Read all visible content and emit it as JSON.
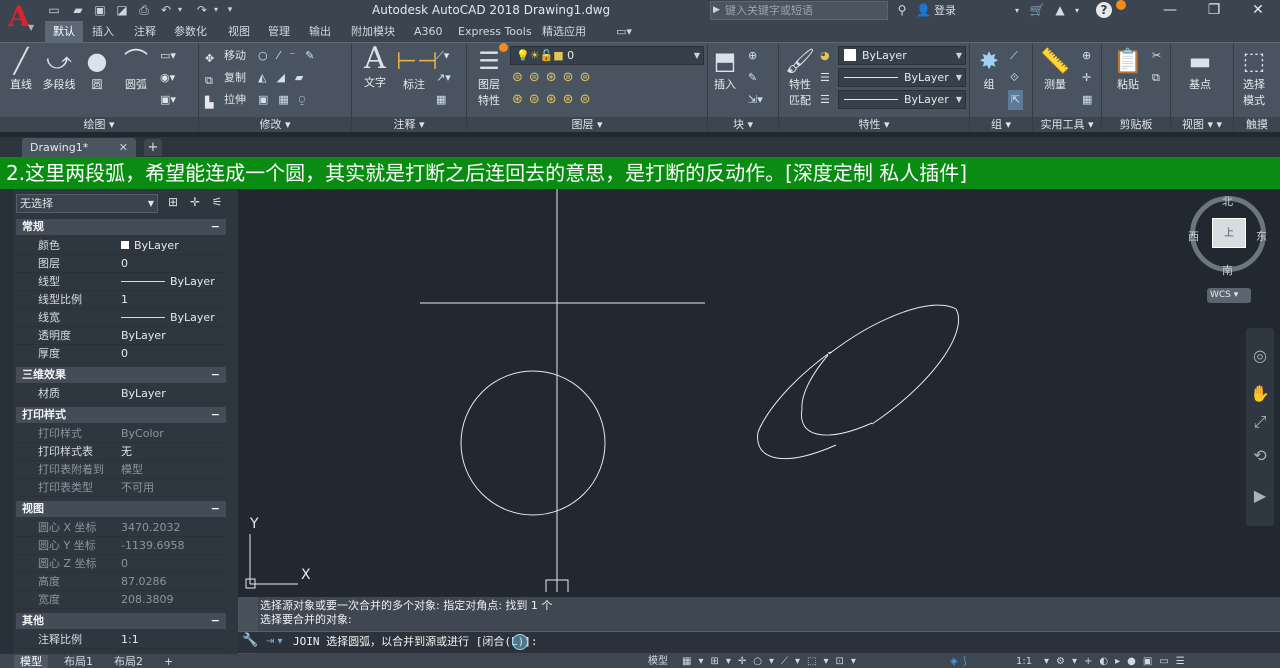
{
  "app": {
    "title": "Autodesk AutoCAD 2018    Drawing1.dwg",
    "logo": "A",
    "search_placeholder": "键入关键字或短语",
    "login_label": "登录",
    "accent_color": "#d9232e"
  },
  "ribbon_tabs": [
    "默认",
    "插入",
    "注释",
    "参数化",
    "视图",
    "管理",
    "输出",
    "附加模块",
    "A360",
    "Express Tools",
    "精选应用"
  ],
  "ribbon": {
    "draw": {
      "line": "直线",
      "polyline": "多段线",
      "circle": "圆",
      "arc": "圆弧",
      "panel": "绘图"
    },
    "modify": {
      "move": "移动",
      "copy": "复制",
      "stretch": "拉伸",
      "panel": "修改"
    },
    "annotation": {
      "text": "文字",
      "dimension": "标注",
      "panel": "注释"
    },
    "layers": {
      "properties_l1": "图层",
      "properties_l2": "特性",
      "current_layer": "0",
      "panel": "图层"
    },
    "block": {
      "insert": "插入",
      "panel": "块"
    },
    "properties": {
      "match_l1": "特性",
      "match_l2": "匹配",
      "color": "ByLayer",
      "linetype": "ByLayer",
      "lineweight": "ByLayer",
      "panel": "特性"
    },
    "groups": {
      "group": "组",
      "panel": "组"
    },
    "utilities": {
      "measure": "测量",
      "panel": "实用工具"
    },
    "clipboard": {
      "paste": "粘贴",
      "panel": "剪贴板"
    },
    "view": {
      "base": "基点",
      "panel": "视图"
    },
    "select": {
      "mode_l1": "选择",
      "mode_l2": "模式",
      "panel": "触摸"
    }
  },
  "document_tab": "Drawing1*",
  "banner_text": "2.这里两段弧，希望能连成一个圆，其实就是打断之后连回去的意思，是打断的反动作。[深度定制 私人插件]",
  "properties_palette": {
    "selection": "无选择",
    "sections": [
      {
        "title": "常规",
        "rows": [
          {
            "k": "颜色",
            "v": "ByLayer",
            "swatch": true
          },
          {
            "k": "图层",
            "v": "0"
          },
          {
            "k": "线型",
            "v": "ByLayer",
            "line": true
          },
          {
            "k": "线型比例",
            "v": "1"
          },
          {
            "k": "线宽",
            "v": "ByLayer",
            "line": true
          },
          {
            "k": "透明度",
            "v": "ByLayer"
          },
          {
            "k": "厚度",
            "v": "0"
          }
        ]
      },
      {
        "title": "三维效果",
        "rows": [
          {
            "k": "材质",
            "v": "ByLayer"
          }
        ]
      },
      {
        "title": "打印样式",
        "rows": [
          {
            "k": "打印样式",
            "v": "ByColor",
            "dim": true
          },
          {
            "k": "打印样式表",
            "v": "无"
          },
          {
            "k": "打印表附着到",
            "v": "模型",
            "dim": true
          },
          {
            "k": "打印表类型",
            "v": "不可用",
            "dim": true
          }
        ]
      },
      {
        "title": "视图",
        "rows": [
          {
            "k": "圆心 X 坐标",
            "v": "3470.2032",
            "dim": true
          },
          {
            "k": "圆心 Y 坐标",
            "v": "-1139.6958",
            "dim": true
          },
          {
            "k": "圆心 Z 坐标",
            "v": "0",
            "dim": true
          },
          {
            "k": "高度",
            "v": "87.0286",
            "dim": true
          },
          {
            "k": "宽度",
            "v": "208.3809",
            "dim": true
          }
        ]
      },
      {
        "title": "其他",
        "rows": [
          {
            "k": "注释比例",
            "v": "1:1"
          }
        ]
      }
    ]
  },
  "viewcube": {
    "north": "北",
    "south": "南",
    "east": "东",
    "west": "西",
    "face": "上",
    "wcs": "WCS"
  },
  "ucs": {
    "x": "X",
    "y": "Y"
  },
  "command": {
    "history": [
      "选择源对象或要一次合并的多个对象: 指定对角点: 找到 1 个",
      "选择要合并的对象:"
    ],
    "prompt": "JOIN 选择圆弧，以合并到源或进行 [闭合(L)]:"
  },
  "layout_tabs": [
    "模型",
    "布局1",
    "布局2"
  ],
  "status_model": "模型",
  "status_scale": "1:1"
}
